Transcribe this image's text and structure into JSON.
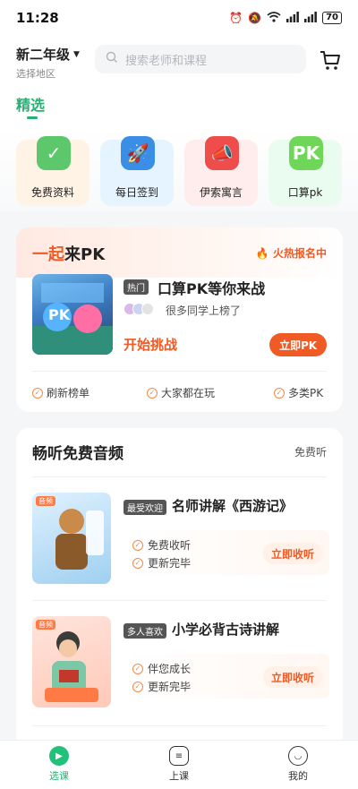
{
  "status": {
    "time": "11:28",
    "battery": "70",
    "icons": [
      "alarm-icon",
      "mute-icon",
      "wifi-icon",
      "signal-icon",
      "signal-icon",
      "battery-icon"
    ]
  },
  "header": {
    "grade": "新二年级",
    "region": "选择地区",
    "search_placeholder": "搜索老师和课程",
    "cart_icon": "cart-icon"
  },
  "tabs": {
    "selected": "精选"
  },
  "features": [
    {
      "label": "免费资料",
      "icon": "clipboard-check-icon",
      "bg": "#fff3e5",
      "icon_color": "#5cc86b"
    },
    {
      "label": "每日签到",
      "icon": "rocket-icon",
      "bg": "#e6f4ff",
      "icon_color": "#3a8ee6"
    },
    {
      "label": "伊索寓言",
      "icon": "megaphone-icon",
      "bg": "#ffecec",
      "icon_color": "#ef4c4c"
    },
    {
      "label": "口算pk",
      "icon": "pk-icon",
      "bg": "#eafbef",
      "icon_color": "#6fd65a"
    }
  ],
  "pk": {
    "title_part1": "一起",
    "title_part2": "来PK",
    "hot": "火热报名中",
    "badge": "热门",
    "name": "口算PK等你来战",
    "people": "很多同学上榜了",
    "start": "开始挑战",
    "button": "立即PK",
    "thumb_text": "PK",
    "features": [
      "刷新榜单",
      "大家都在玩",
      "多类PK"
    ]
  },
  "audio": {
    "title": "畅听免费音频",
    "more": "免费听",
    "items": [
      {
        "cover_tag": "音频",
        "badge": "最受欢迎",
        "title": "名师讲解《西游记》",
        "features": [
          "免费收听",
          "更新完毕"
        ],
        "button": "立即收听"
      },
      {
        "cover_tag": "音频",
        "badge": "多人喜欢",
        "title": "小学必背古诗讲解",
        "features": [
          "伴您成长",
          "更新完毕"
        ],
        "button": "立即收听"
      }
    ]
  },
  "bottom_nav": [
    {
      "label": "选课",
      "active": true,
      "icon": "play-icon"
    },
    {
      "label": "上课",
      "active": false,
      "icon": "class-icon"
    },
    {
      "label": "我的",
      "active": false,
      "icon": "profile-icon"
    }
  ]
}
